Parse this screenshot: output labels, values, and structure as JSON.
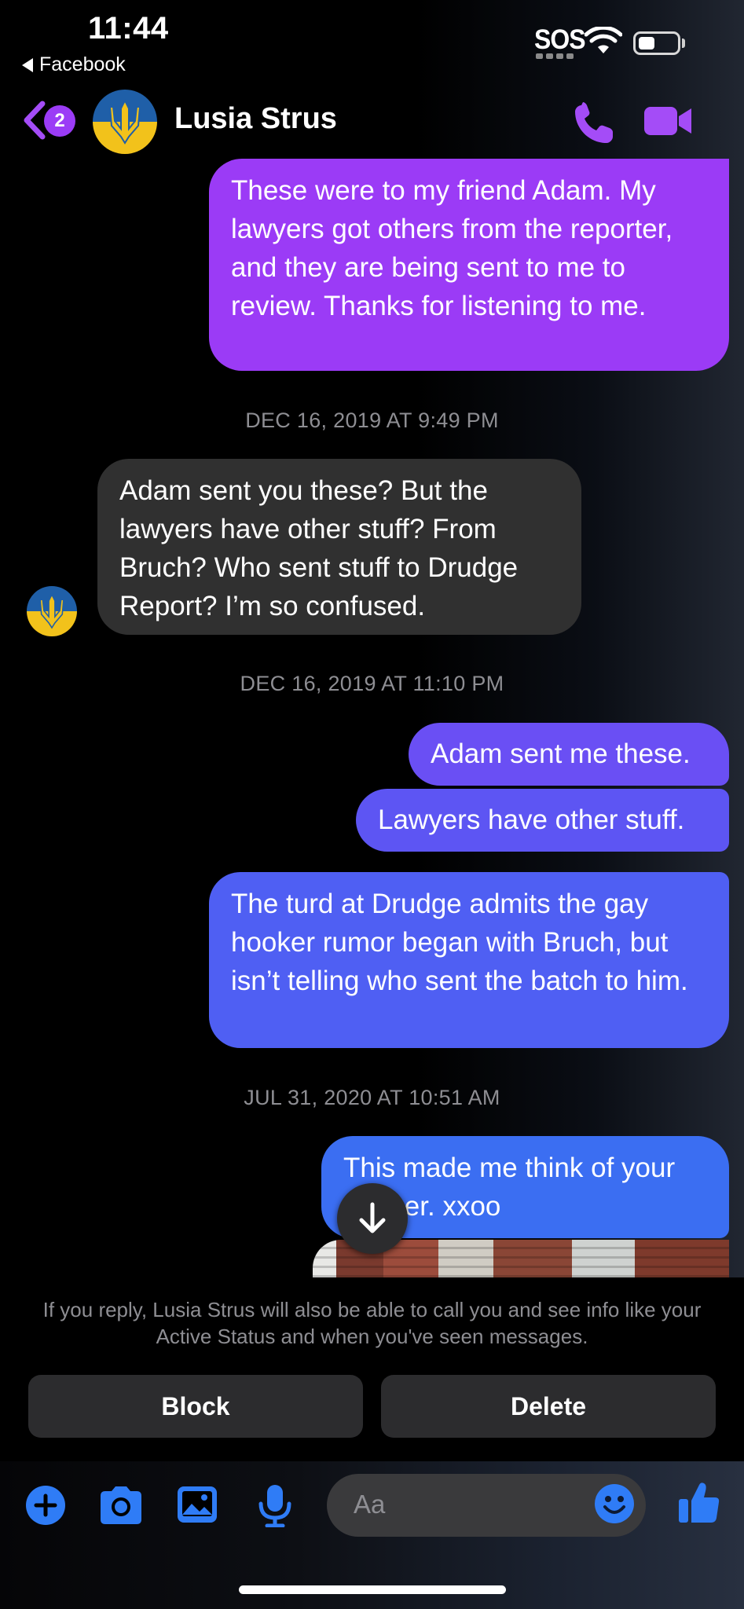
{
  "status_bar": {
    "time": "11:44",
    "back_app": "Facebook",
    "carrier": "SOS"
  },
  "header": {
    "back_badge_count": "2",
    "contact_name": "Lusia Strus",
    "accent_color": "#a44cf7"
  },
  "messages": [
    {
      "id": "m1",
      "direction": "sent",
      "text": "These were to my friend Adam. My lawyers got others from the reporter, and they are being sent to me to review. Thanks for listening to me.",
      "color": "#9b3bf6"
    },
    {
      "id": "t1",
      "type": "timestamp",
      "text": "DEC 16, 2019 AT 9:49 PM"
    },
    {
      "id": "m2",
      "direction": "received",
      "text": "Adam sent you these?  But the lawyers have other stuff? From Bruch? Who sent stuff to Drudge Report? I’m so confused."
    },
    {
      "id": "t2",
      "type": "timestamp",
      "text": "DEC 16, 2019 AT 11:10 PM"
    },
    {
      "id": "m3",
      "direction": "sent",
      "text": "Adam sent me these.",
      "color": "#6a4ff4"
    },
    {
      "id": "m4",
      "direction": "sent",
      "text": "Lawyers have other stuff.",
      "color": "#5d55f3"
    },
    {
      "id": "m5",
      "direction": "sent",
      "text": "The turd at Drudge admits the gay hooker rumor began with Bruch, but isn’t telling who sent the batch to him.",
      "color": "#4f5ff3"
    },
    {
      "id": "t3",
      "type": "timestamp",
      "text": "JUL 31, 2020 AT 10:51 AM"
    },
    {
      "id": "m6",
      "direction": "sent",
      "text": "This made me think of your mother. xxoo",
      "color": "#3b6ef2"
    }
  ],
  "bottom": {
    "notice": "If you reply, Lusia Strus will also be able to call you and see info like your Active Status and when you've seen messages.",
    "block_label": "Block",
    "delete_label": "Delete"
  },
  "composer": {
    "placeholder": "Aa",
    "icon_color": "#2f7cf6",
    "icons": [
      "plus-icon",
      "camera-icon",
      "photo-icon",
      "microphone-icon",
      "emoji-icon",
      "like-icon"
    ]
  }
}
